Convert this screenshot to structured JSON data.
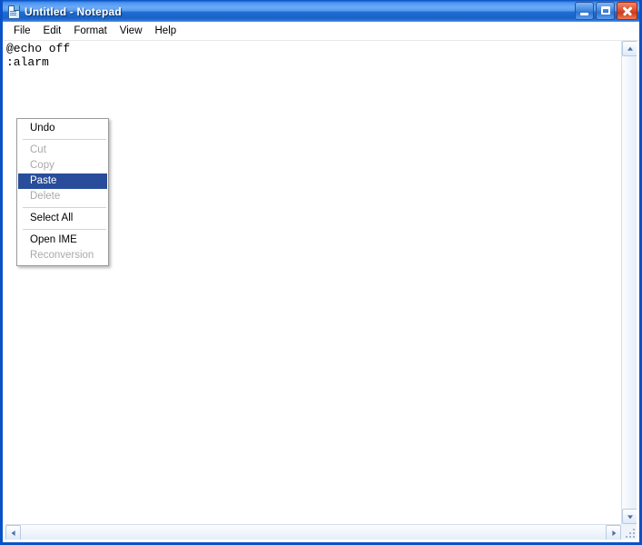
{
  "window": {
    "title": "Untitled - Notepad",
    "icon": "notepad-icon",
    "controls": {
      "minimize": "Minimize",
      "maximize": "Maximize",
      "close": "Close"
    },
    "accent_title_color": "#1f6cd4",
    "border_color": "#0a52c8"
  },
  "menubar": {
    "items": [
      {
        "label": "File"
      },
      {
        "label": "Edit"
      },
      {
        "label": "Format"
      },
      {
        "label": "View"
      },
      {
        "label": "Help"
      }
    ]
  },
  "document": {
    "lines": [
      "@echo off",
      ":alarm"
    ]
  },
  "context_menu": {
    "highlight_color": "#2a4d9b",
    "items": [
      {
        "label": "Undo",
        "state": "enabled",
        "separator_after": true
      },
      {
        "label": "Cut",
        "state": "disabled",
        "separator_after": false
      },
      {
        "label": "Copy",
        "state": "disabled",
        "separator_after": false
      },
      {
        "label": "Paste",
        "state": "selected",
        "separator_after": false
      },
      {
        "label": "Delete",
        "state": "disabled",
        "separator_after": true
      },
      {
        "label": "Select All",
        "state": "enabled",
        "separator_after": true
      },
      {
        "label": "Open IME",
        "state": "enabled",
        "separator_after": false
      },
      {
        "label": "Reconversion",
        "state": "disabled",
        "separator_after": false
      }
    ]
  },
  "scrollbars": {
    "vertical": {
      "up_arrow": "scroll-up-arrow",
      "down_arrow": "scroll-down-arrow"
    },
    "horizontal": {
      "left_arrow": "scroll-left-arrow",
      "right_arrow": "scroll-right-arrow"
    },
    "resize_grip": "resize-grip"
  }
}
